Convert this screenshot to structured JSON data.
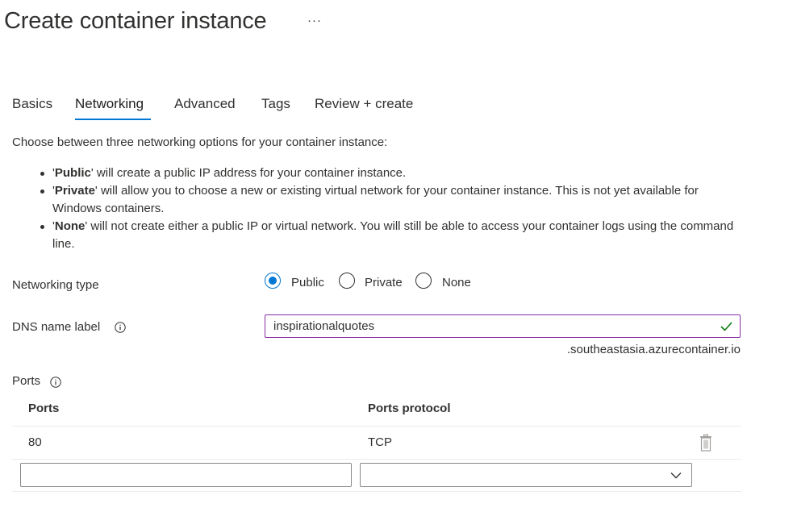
{
  "header": {
    "title": "Create container instance",
    "more_label": "···"
  },
  "tabs": [
    {
      "label": "Basics",
      "active": false
    },
    {
      "label": "Networking",
      "active": true
    },
    {
      "label": "Advanced",
      "active": false
    },
    {
      "label": "Tags",
      "active": false
    },
    {
      "label": "Review + create",
      "active": false
    }
  ],
  "intro": {
    "text": "Choose between three networking options for your container instance:",
    "bullets": [
      {
        "quote_open": "'",
        "name": "Public",
        "text": "' will create a public IP address for your container instance."
      },
      {
        "quote_open": "'",
        "name": "Private",
        "text": "' will allow you to choose a new or existing virtual network for your container instance. This is not yet available for Windows containers."
      },
      {
        "quote_open": "'",
        "name": "None",
        "text": "' will not create either a public IP or virtual network. You will still be able to access your container logs using the command line."
      }
    ]
  },
  "networking_type": {
    "label": "Networking type",
    "options": [
      {
        "label": "Public",
        "selected": true
      },
      {
        "label": "Private",
        "selected": false
      },
      {
        "label": "None",
        "selected": false
      }
    ]
  },
  "dns": {
    "label": "DNS name label",
    "info_icon": "info-icon",
    "value": "inspirationalquotes",
    "valid_icon": "checkmark-icon",
    "suffix": ".southeastasia.azurecontainer.io"
  },
  "ports": {
    "label": "Ports",
    "info_icon": "info-icon",
    "columns": [
      "Ports",
      "Ports protocol"
    ],
    "rows": [
      {
        "port": "80",
        "protocol": "TCP",
        "delete_icon": "trash-icon"
      }
    ],
    "new_row": {
      "port_value": "",
      "protocol_value": "",
      "dropdown_icon": "chevron-down-icon"
    }
  },
  "colors": {
    "accent": "#0078d4",
    "valid_border": "#8a2da5",
    "valid_check": "#107c10",
    "text": "#323130",
    "divider": "#edebe9"
  }
}
